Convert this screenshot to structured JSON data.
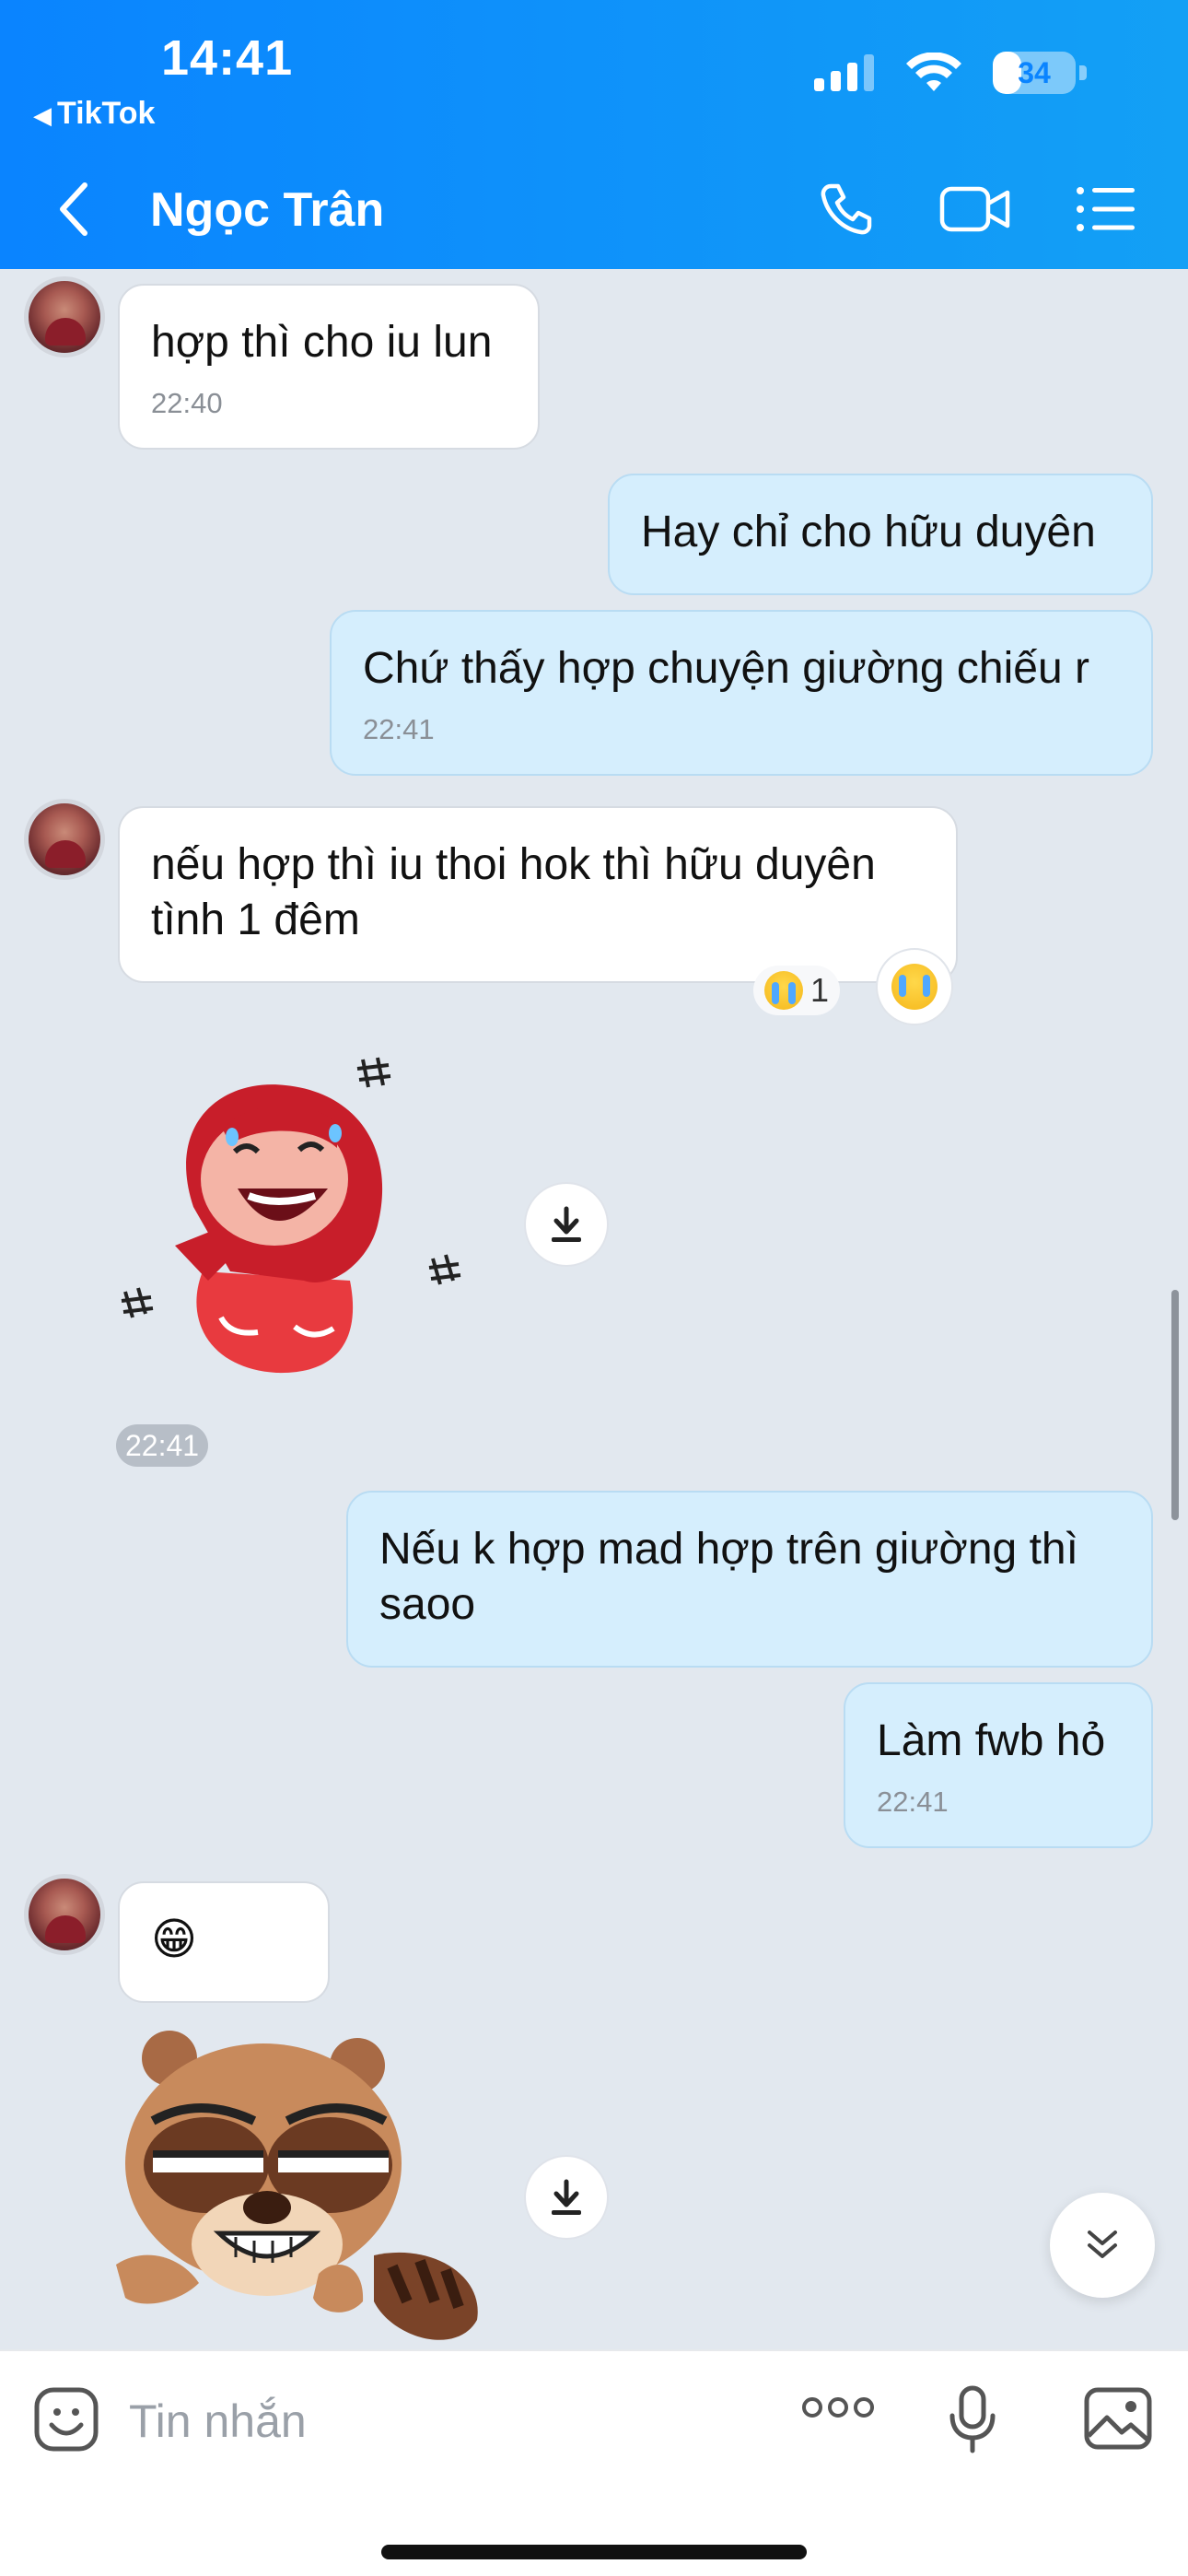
{
  "status_bar": {
    "time": "14:41",
    "back_app": "TikTok",
    "battery": "34",
    "battery_level": 0.34
  },
  "header": {
    "contact_name": "Ngọc Trân",
    "icons": [
      "back-chevron-icon",
      "phone-icon",
      "video-call-icon",
      "menu-list-icon"
    ]
  },
  "messages": [
    {
      "side": "in",
      "text": "hợp thì cho iu lun",
      "time": "22:40"
    },
    {
      "side": "out",
      "text": "Hay chỉ cho hữu duyên",
      "time": ""
    },
    {
      "side": "out",
      "text": "Chứ thấy hợp chuyện giường chiếu r",
      "time": "22:41"
    },
    {
      "side": "in",
      "text": "nếu hợp thì iu thoi hok thì hữu duyên tình 1 đêm",
      "time": "",
      "reaction": {
        "emoji": "crying-face",
        "count": "1"
      }
    },
    {
      "side": "in",
      "type": "sticker",
      "sticker": "red-hood-girl-laughing-sticker"
    },
    {
      "side": "in",
      "type": "time-chip",
      "time": "22:41"
    },
    {
      "side": "out",
      "text": "Nếu k hợp mad hợp trên giường thì saoo",
      "time": ""
    },
    {
      "side": "out",
      "text": "Làm fwb hỏ",
      "time": "22:41"
    },
    {
      "side": "in",
      "text": "😁",
      "time": ""
    },
    {
      "side": "in",
      "type": "sticker",
      "sticker": "raccoon-smirk-sticker"
    }
  ],
  "composer": {
    "placeholder": "Tin nhắn",
    "value": ""
  },
  "colors": {
    "header_start": "#0a84ff",
    "header_end": "#13a0f5",
    "background": "#e2e8ef",
    "incoming_bubble": "#ffffff",
    "outgoing_bubble": "#d5eefd"
  }
}
